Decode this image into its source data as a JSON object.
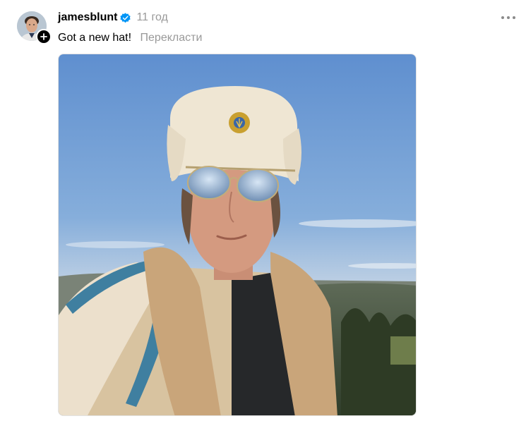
{
  "post": {
    "author": {
      "username": "jamesblunt",
      "verified": true,
      "avatar_icon": "profile-photo",
      "follow_icon": "plus-icon"
    },
    "timestamp": "11 год",
    "caption": "Got a new hat!",
    "translate_label": "Перекласти",
    "more_icon": "more-horizontal-icon",
    "media": {
      "type": "photo"
    }
  },
  "colors": {
    "text_primary": "#000000",
    "text_secondary": "#999999",
    "verified_blue": "#0095f6",
    "badge_bg": "#000000"
  }
}
